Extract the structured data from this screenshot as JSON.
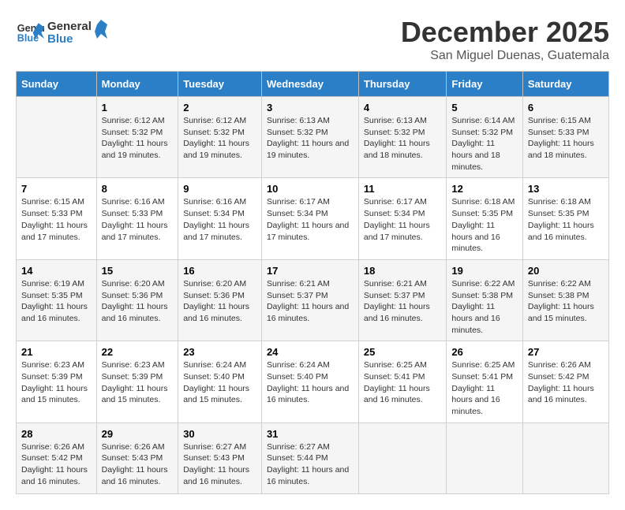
{
  "logo": {
    "line1": "General",
    "line2": "Blue"
  },
  "title": "December 2025",
  "location": "San Miguel Duenas, Guatemala",
  "days_header": [
    "Sunday",
    "Monday",
    "Tuesday",
    "Wednesday",
    "Thursday",
    "Friday",
    "Saturday"
  ],
  "weeks": [
    [
      {
        "day": "",
        "info": ""
      },
      {
        "day": "1",
        "info": "Sunrise: 6:12 AM\nSunset: 5:32 PM\nDaylight: 11 hours and 19 minutes."
      },
      {
        "day": "2",
        "info": "Sunrise: 6:12 AM\nSunset: 5:32 PM\nDaylight: 11 hours and 19 minutes."
      },
      {
        "day": "3",
        "info": "Sunrise: 6:13 AM\nSunset: 5:32 PM\nDaylight: 11 hours and 19 minutes."
      },
      {
        "day": "4",
        "info": "Sunrise: 6:13 AM\nSunset: 5:32 PM\nDaylight: 11 hours and 18 minutes."
      },
      {
        "day": "5",
        "info": "Sunrise: 6:14 AM\nSunset: 5:32 PM\nDaylight: 11 hours and 18 minutes."
      },
      {
        "day": "6",
        "info": "Sunrise: 6:15 AM\nSunset: 5:33 PM\nDaylight: 11 hours and 18 minutes."
      }
    ],
    [
      {
        "day": "7",
        "info": "Sunrise: 6:15 AM\nSunset: 5:33 PM\nDaylight: 11 hours and 17 minutes."
      },
      {
        "day": "8",
        "info": "Sunrise: 6:16 AM\nSunset: 5:33 PM\nDaylight: 11 hours and 17 minutes."
      },
      {
        "day": "9",
        "info": "Sunrise: 6:16 AM\nSunset: 5:34 PM\nDaylight: 11 hours and 17 minutes."
      },
      {
        "day": "10",
        "info": "Sunrise: 6:17 AM\nSunset: 5:34 PM\nDaylight: 11 hours and 17 minutes."
      },
      {
        "day": "11",
        "info": "Sunrise: 6:17 AM\nSunset: 5:34 PM\nDaylight: 11 hours and 17 minutes."
      },
      {
        "day": "12",
        "info": "Sunrise: 6:18 AM\nSunset: 5:35 PM\nDaylight: 11 hours and 16 minutes."
      },
      {
        "day": "13",
        "info": "Sunrise: 6:18 AM\nSunset: 5:35 PM\nDaylight: 11 hours and 16 minutes."
      }
    ],
    [
      {
        "day": "14",
        "info": "Sunrise: 6:19 AM\nSunset: 5:35 PM\nDaylight: 11 hours and 16 minutes."
      },
      {
        "day": "15",
        "info": "Sunrise: 6:20 AM\nSunset: 5:36 PM\nDaylight: 11 hours and 16 minutes."
      },
      {
        "day": "16",
        "info": "Sunrise: 6:20 AM\nSunset: 5:36 PM\nDaylight: 11 hours and 16 minutes."
      },
      {
        "day": "17",
        "info": "Sunrise: 6:21 AM\nSunset: 5:37 PM\nDaylight: 11 hours and 16 minutes."
      },
      {
        "day": "18",
        "info": "Sunrise: 6:21 AM\nSunset: 5:37 PM\nDaylight: 11 hours and 16 minutes."
      },
      {
        "day": "19",
        "info": "Sunrise: 6:22 AM\nSunset: 5:38 PM\nDaylight: 11 hours and 16 minutes."
      },
      {
        "day": "20",
        "info": "Sunrise: 6:22 AM\nSunset: 5:38 PM\nDaylight: 11 hours and 15 minutes."
      }
    ],
    [
      {
        "day": "21",
        "info": "Sunrise: 6:23 AM\nSunset: 5:39 PM\nDaylight: 11 hours and 15 minutes."
      },
      {
        "day": "22",
        "info": "Sunrise: 6:23 AM\nSunset: 5:39 PM\nDaylight: 11 hours and 15 minutes."
      },
      {
        "day": "23",
        "info": "Sunrise: 6:24 AM\nSunset: 5:40 PM\nDaylight: 11 hours and 15 minutes."
      },
      {
        "day": "24",
        "info": "Sunrise: 6:24 AM\nSunset: 5:40 PM\nDaylight: 11 hours and 16 minutes."
      },
      {
        "day": "25",
        "info": "Sunrise: 6:25 AM\nSunset: 5:41 PM\nDaylight: 11 hours and 16 minutes."
      },
      {
        "day": "26",
        "info": "Sunrise: 6:25 AM\nSunset: 5:41 PM\nDaylight: 11 hours and 16 minutes."
      },
      {
        "day": "27",
        "info": "Sunrise: 6:26 AM\nSunset: 5:42 PM\nDaylight: 11 hours and 16 minutes."
      }
    ],
    [
      {
        "day": "28",
        "info": "Sunrise: 6:26 AM\nSunset: 5:42 PM\nDaylight: 11 hours and 16 minutes."
      },
      {
        "day": "29",
        "info": "Sunrise: 6:26 AM\nSunset: 5:43 PM\nDaylight: 11 hours and 16 minutes."
      },
      {
        "day": "30",
        "info": "Sunrise: 6:27 AM\nSunset: 5:43 PM\nDaylight: 11 hours and 16 minutes."
      },
      {
        "day": "31",
        "info": "Sunrise: 6:27 AM\nSunset: 5:44 PM\nDaylight: 11 hours and 16 minutes."
      },
      {
        "day": "",
        "info": ""
      },
      {
        "day": "",
        "info": ""
      },
      {
        "day": "",
        "info": ""
      }
    ]
  ]
}
